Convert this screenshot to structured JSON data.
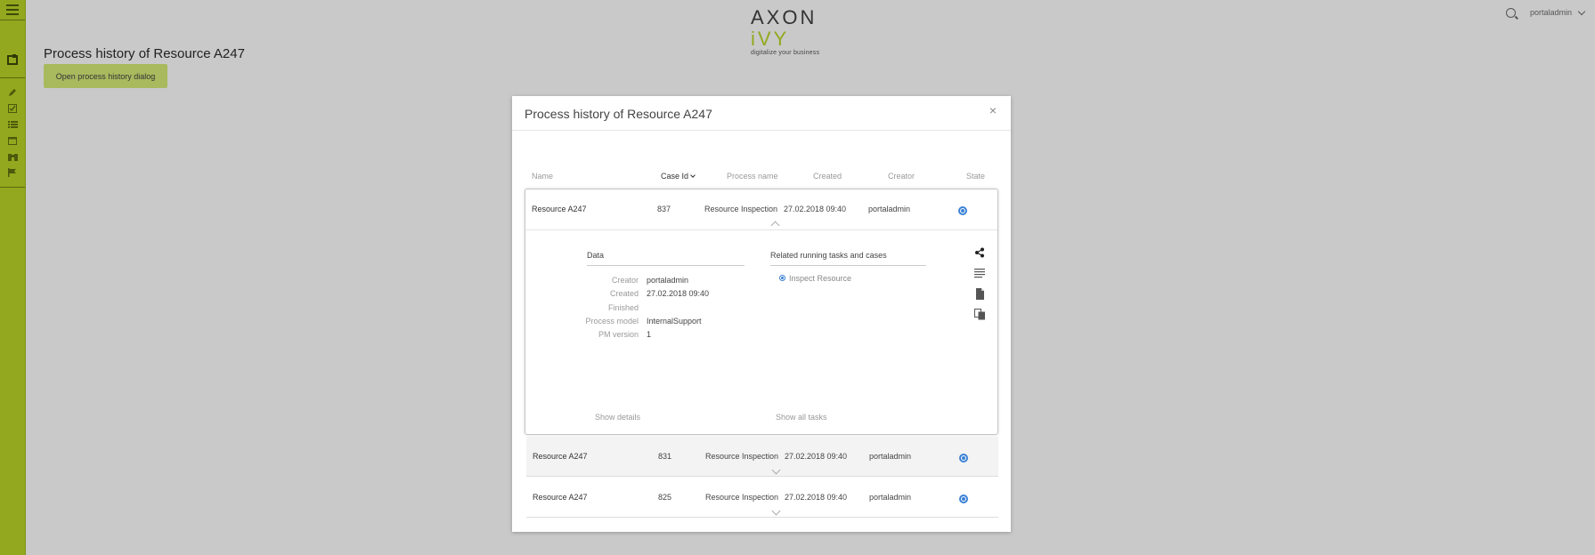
{
  "header": {
    "logo_main": "AXON",
    "logo_accent": "iVY",
    "logo_tagline": "digitalize your business",
    "user": "portaladmin"
  },
  "page": {
    "title": "Process history of Resource A247",
    "open_button": "Open process history dialog"
  },
  "dialog": {
    "title": "Process history of Resource A247",
    "close": "×",
    "columns": [
      "Name",
      "Case Id",
      "Process name",
      "Created",
      "Creator",
      "State"
    ],
    "sort_column": "Case Id",
    "rows": [
      {
        "name": "Resource A247",
        "case_id": "837",
        "process": "Resource Inspection",
        "created": "27.02.2018 09:40",
        "creator": "portaladmin",
        "state": "running"
      },
      {
        "name": "Resource A247",
        "case_id": "831",
        "process": "Resource Inspection",
        "created": "27.02.2018 09:40",
        "creator": "portaladmin",
        "state": "running"
      },
      {
        "name": "Resource A247",
        "case_id": "825",
        "process": "Resource Inspection",
        "created": "27.02.2018 09:40",
        "creator": "portaladmin",
        "state": "running"
      }
    ],
    "details": {
      "data_title": "Data",
      "related_title": "Related running tasks and cases",
      "fields": [
        {
          "label": "Creator",
          "value": "portaladmin"
        },
        {
          "label": "Created",
          "value": "27.02.2018 09:40"
        },
        {
          "label": "Finished",
          "value": ""
        },
        {
          "label": "Process model",
          "value": "InternalSupport"
        },
        {
          "label": "PM version",
          "value": "1"
        }
      ],
      "related_items": [
        "Inspect Resource"
      ],
      "show_details": "Show details",
      "show_all_tasks": "Show all tasks",
      "actions": [
        "share-icon",
        "description-icon",
        "document-icon",
        "copy-icon"
      ]
    }
  },
  "colors": {
    "brand_green": "#93a81e",
    "background": "#c9c9c9",
    "state_blue": "#3b82d6"
  }
}
